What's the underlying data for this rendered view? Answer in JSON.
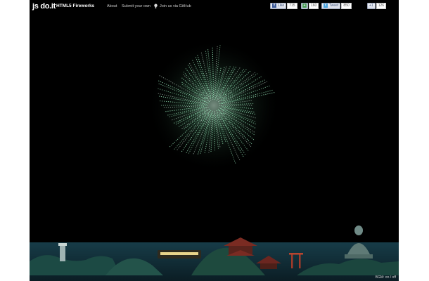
{
  "header": {
    "logo": "js do.it",
    "app_title": "HTML5 Fireworks",
    "nav": [
      {
        "label": "About"
      },
      {
        "label": "Submit your own"
      },
      {
        "label": "Join us via GitHub"
      }
    ]
  },
  "social": {
    "like": {
      "label": "Like",
      "count": "715"
    },
    "share": {
      "count": "160"
    },
    "tweet": {
      "label": "Tweet",
      "count": "850"
    },
    "plusone": {
      "label": "+1",
      "count": "126"
    }
  },
  "footer": {
    "credit": "BGM: on / off"
  },
  "colors": {
    "background": "#000000",
    "firework": "#9ff0c2",
    "hills": "#1e4a3e",
    "water": "#0f2e38"
  },
  "icons": [
    "github-icon",
    "facebook-icon",
    "share-icon",
    "twitter-icon",
    "google-plus-icon"
  ]
}
